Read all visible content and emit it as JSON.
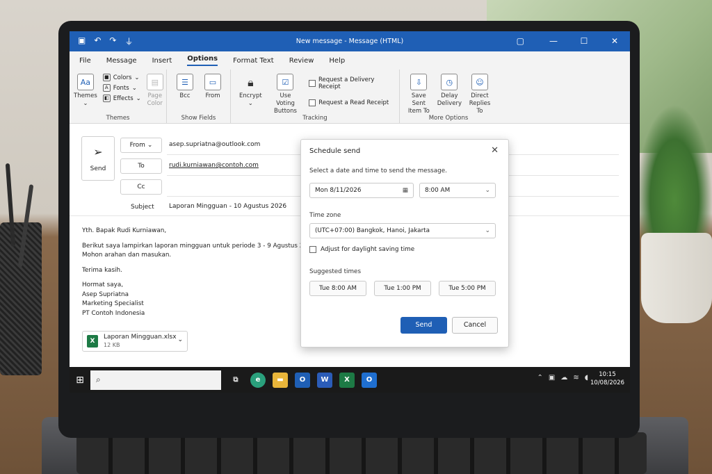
{
  "window": {
    "title": "New message  -  Message (HTML)"
  },
  "menu": {
    "tabs": [
      "File",
      "Message",
      "Insert",
      "Options",
      "Format Text",
      "Review",
      "Help"
    ],
    "active": "Options"
  },
  "ribbon": {
    "themes": {
      "themes_label": "Themes",
      "colors_label": "Colors",
      "fonts_label": "Fonts",
      "effects_label": "Effects",
      "page_color_label1": "Page",
      "page_color_label2": "Color",
      "group": "Themes"
    },
    "show_fields": {
      "bcc_label": "Bcc",
      "from_label": "From",
      "group": "Show Fields"
    },
    "tracking": {
      "encrypt_label": "Encrypt",
      "voting_label1": "Use Voting",
      "voting_label2": "Buttons",
      "delivery_receipt": "Request a Delivery Receipt",
      "read_receipt": "Request a Read Receipt",
      "group": "Tracking"
    },
    "more_options": {
      "save_sent_label1": "Save Sent",
      "save_sent_label2": "Item To",
      "delay_label1": "Delay",
      "delay_label2": "Delivery",
      "direct_label1": "Direct",
      "direct_label2": "Replies To",
      "group": "More Options"
    }
  },
  "compose": {
    "send_label": "Send",
    "from_label": "From",
    "from_value": "asep.supriatna@outlook.com",
    "to_label": "To",
    "to_value": "rudi.kurniawan@contoh.com",
    "cc_label": "Cc",
    "subject_label": "Subject",
    "subject_value": "Laporan Mingguan - 10 Agustus 2026",
    "body": {
      "greeting": "Yth. Bapak Rudi Kurniawan,",
      "line1": "Berikut saya lampirkan laporan mingguan untuk periode 3 - 9 Agustus 2026.",
      "line2": "Mohon arahan dan masukan.",
      "thanks": "Terima kasih.",
      "closing": "Hormat saya,",
      "sig_name": "Asep Supriatna",
      "sig_title": "Marketing Specialist",
      "sig_company": "PT Contoh Indonesia"
    },
    "attachment": {
      "name": "Laporan Mingguan.xlsx",
      "size": "12 KB"
    }
  },
  "dialog": {
    "title": "Schedule send",
    "instruction": "Select a date and time to send the message.",
    "date": "Mon 8/11/2026",
    "time": "8:00 AM",
    "timezone_label": "Time zone",
    "timezone": "(UTC+07:00) Bangkok, Hanoi, Jakarta",
    "dst_label": "Adjust for daylight saving time",
    "suggested_label": "Suggested times",
    "suggestions": [
      "Tue 8:00 AM",
      "Tue 1:00 PM",
      "Tue 5:00 PM"
    ],
    "send_label": "Send",
    "cancel_label": "Cancel"
  },
  "taskbar": {
    "time": "10:15",
    "date": "10/08/2026"
  },
  "colors": {
    "accent": "#1f5fb5",
    "excel": "#1d7a45"
  }
}
